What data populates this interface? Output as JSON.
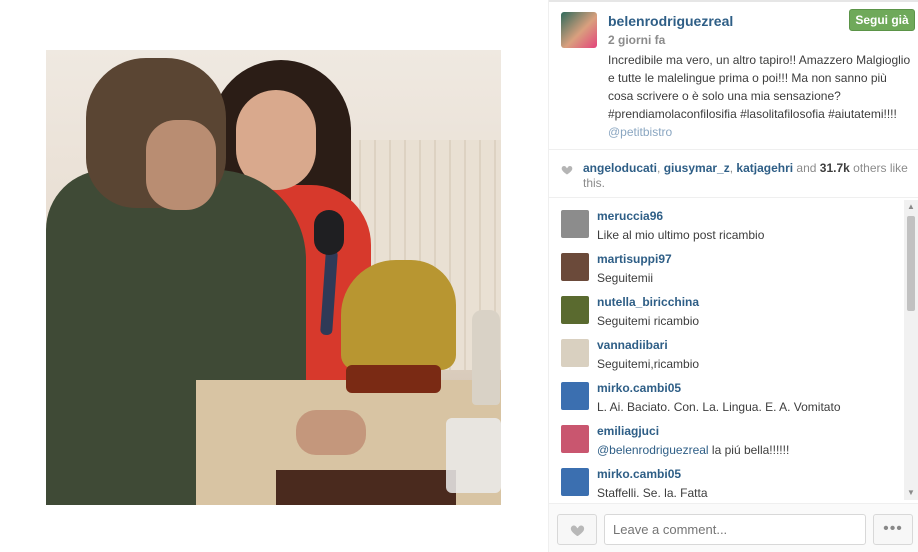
{
  "post": {
    "username": "belenrodriguezreal",
    "time": "2 giorni fa",
    "follow_label": "Segui già",
    "caption_text": "Incredibile ma vero, un altro tapiro!! Amazzero Malgioglio e tutte le malelingue prima o poi!!! Ma non sanno più cosa scrivere o è solo una mia sensazione? #prendiamolaconfilosifia #lasolitafilosofia #aiutatemi!!!!",
    "caption_mention": "@petitbistro",
    "photo_alt": "Photo"
  },
  "likes": {
    "user1": "angeloducati",
    "sep1": ", ",
    "user2": "giusymar_z",
    "sep2": ", ",
    "user3": "katjagehri",
    "and_text": " and ",
    "count": "31.7k",
    "others_text": " others like this."
  },
  "comments": [
    {
      "user": "meruccia96",
      "text": "Like al mio ultimo post ricambio",
      "avatar_color": "#8c8c8c"
    },
    {
      "user": "martisuppi97",
      "text": "Seguitemii",
      "avatar_color": "#6b4a3a"
    },
    {
      "user": "nutella_biricchina",
      "text": "Seguitemi ricambio",
      "avatar_color": "#5a6a2f"
    },
    {
      "user": "vannadiibari",
      "text": "Seguitemi,ricambio",
      "avatar_color": "#d9d0c0"
    },
    {
      "user": "mirko.cambi05",
      "text": "L. Ai. Baciato. Con. La. Lingua. E. A. Vomitato ",
      "avatar_color": "#3b6fb0"
    },
    {
      "user": "emiliagjuci",
      "mention": "@belenrodriguezreal",
      "text": " la piú bella!!!!!!",
      "avatar_color": "#c9566f"
    },
    {
      "user": "mirko.cambi05",
      "text": "Staffelli. Se. la. Fatta",
      "avatar_color": "#3b6fb0"
    }
  ],
  "footer": {
    "comment_placeholder": "Leave a comment...",
    "more_label": "•••"
  },
  "colors": {
    "link": "#2e5e86",
    "follow_green": "#6fa95a",
    "muted": "#8b8b8b"
  }
}
